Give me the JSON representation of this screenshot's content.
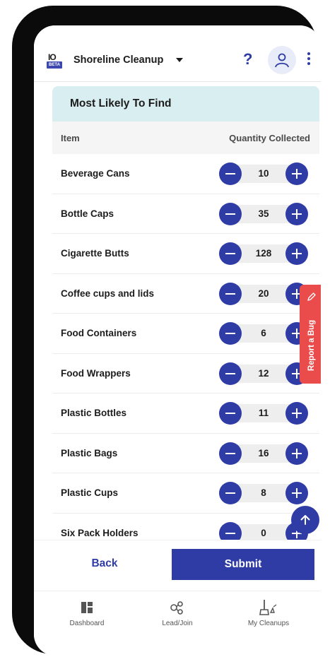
{
  "header": {
    "logo_text": "IO",
    "logo_badge": "BETA",
    "program_name": "Shoreline Cleanup"
  },
  "card": {
    "title": "Most Likely To Find",
    "col_item": "Item",
    "col_quantity": "Quantity Collected",
    "items": [
      {
        "name": "Beverage Cans",
        "qty": "10"
      },
      {
        "name": "Bottle Caps",
        "qty": "35"
      },
      {
        "name": "Cigarette Butts",
        "qty": "128"
      },
      {
        "name": "Coffee cups and lids",
        "qty": "20"
      },
      {
        "name": "Food Containers",
        "qty": "6"
      },
      {
        "name": "Food Wrappers",
        "qty": "12"
      },
      {
        "name": "Plastic Bottles",
        "qty": "11"
      },
      {
        "name": "Plastic Bags",
        "qty": "16"
      },
      {
        "name": "Plastic Cups",
        "qty": "8"
      },
      {
        "name": "Six Pack Holders",
        "qty": "0"
      }
    ]
  },
  "report_bug_label": "Report a Bug",
  "actions": {
    "back_label": "Back",
    "submit_label": "Submit"
  },
  "nav": {
    "dashboard": "Dashboard",
    "lead_join": "Lead/Join",
    "my_cleanups": "My Cleanups"
  },
  "colors": {
    "primary": "#2f3ca5",
    "card_header": "#d9eef1",
    "report_bug": "#ea4b4b"
  }
}
